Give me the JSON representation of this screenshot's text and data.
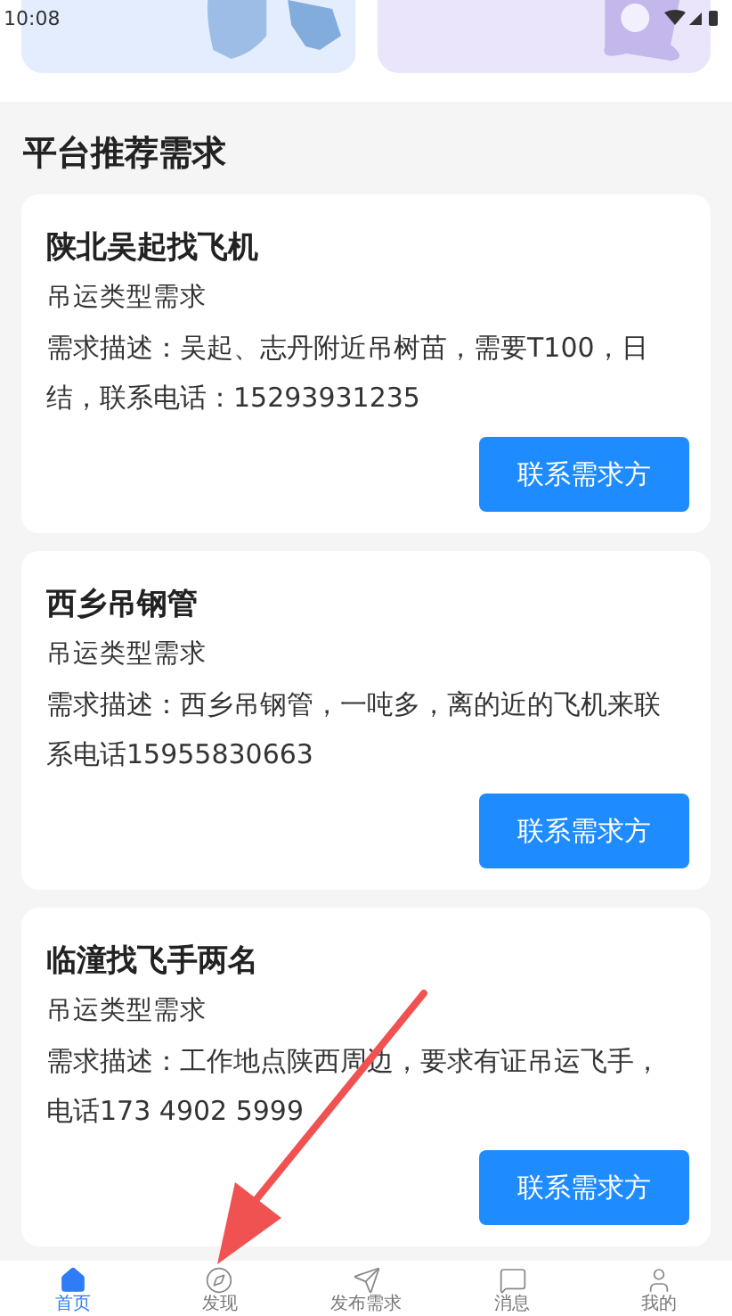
{
  "status_bar": {
    "time": "10:08"
  },
  "section_title": "平台推荐需求",
  "demands": [
    {
      "title": "陕北吴起找飞机",
      "type": "吊运类型需求",
      "description": "需求描述：吴起、志丹附近吊树苗，需要T100，日结，联系电话：15293931235",
      "button": "联系需求方"
    },
    {
      "title": "西乡吊钢管",
      "type": "吊运类型需求",
      "description": "需求描述：西乡吊钢管，一吨多，离的近的飞机来联系电话15955830663",
      "button": "联系需求方"
    },
    {
      "title": "临潼找飞手两名",
      "type": "吊运类型需求",
      "description": "需求描述：工作地点陕西周边，要求有证吊运飞手，电话173 4902 5999",
      "button": "联系需求方"
    }
  ],
  "tab_bar": [
    {
      "label": "首页",
      "selected": true
    },
    {
      "label": "发现",
      "selected": false
    },
    {
      "label": "发布需求",
      "selected": false
    },
    {
      "label": "消息",
      "selected": false
    },
    {
      "label": "我的",
      "selected": false
    }
  ],
  "annotation": {
    "kind": "arrow"
  }
}
